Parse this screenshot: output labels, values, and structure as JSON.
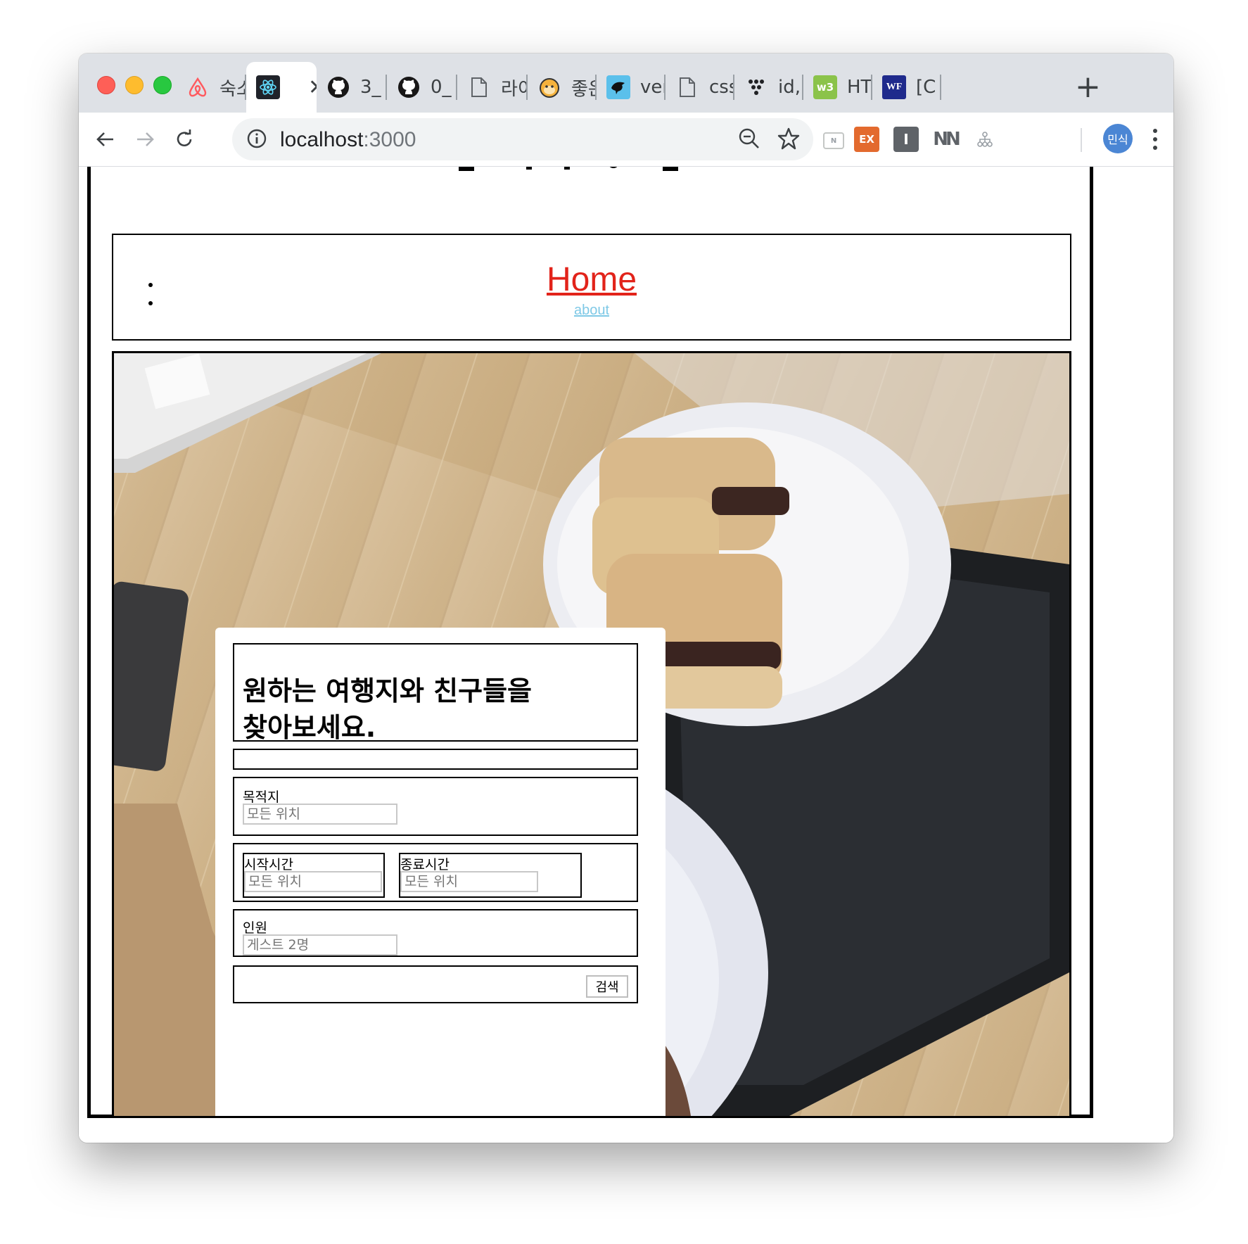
{
  "browser": {
    "tabs": [
      {
        "title": "숙소",
        "icon": "airbnb-icon",
        "active": false
      },
      {
        "title": "",
        "icon": "react-icon",
        "active": true
      },
      {
        "title": "3_",
        "icon": "github-icon",
        "active": false
      },
      {
        "title": "0_",
        "icon": "github-icon",
        "active": false
      },
      {
        "title": "라이",
        "icon": "document-icon",
        "active": false
      },
      {
        "title": "좋은",
        "icon": "monkey-icon",
        "active": false
      },
      {
        "title": "ver",
        "icon": "bird-icon",
        "active": false
      },
      {
        "title": "css",
        "icon": "document-icon",
        "active": false
      },
      {
        "title": "id,",
        "icon": "dots-icon",
        "active": false
      },
      {
        "title": "HT",
        "icon": "w3-icon",
        "active": false
      },
      {
        "title": "[C",
        "icon": "wf-icon",
        "active": false
      }
    ],
    "new_tab_label": "+",
    "url_host": "localhost",
    "url_port": ":3000",
    "extensions": [
      {
        "name": "reader-extension-icon",
        "label": "N",
        "color": "#e8eaed"
      },
      {
        "name": "ex-extension-icon",
        "label": "EX",
        "color": "#e36a2e"
      },
      {
        "name": "i-extension-icon",
        "label": "I",
        "color": "#5f6368"
      },
      {
        "name": "nn-extension-icon",
        "label": "NN",
        "color": "#5f6368"
      },
      {
        "name": "sitemap-extension-icon",
        "label": "",
        "color": "#9aa0a6"
      }
    ],
    "profile_label": "민식",
    "accent": "#4b86d4"
  },
  "page": {
    "nav": {
      "home": "Home",
      "about": "about",
      "home_color": "#e2231a",
      "about_color": "#7fc9e6"
    },
    "form": {
      "headline": "원하는 여행지와 친구들을 찾아보세요.",
      "destination_label": "목적지",
      "destination_placeholder": "모든 위치",
      "start_label": "시작시간",
      "start_placeholder": "모든 위치",
      "end_label": "종료시간",
      "end_placeholder": "모든 위치",
      "guests_label": "인원",
      "guests_placeholder": "게스트 2명",
      "search_button": "검색"
    }
  }
}
